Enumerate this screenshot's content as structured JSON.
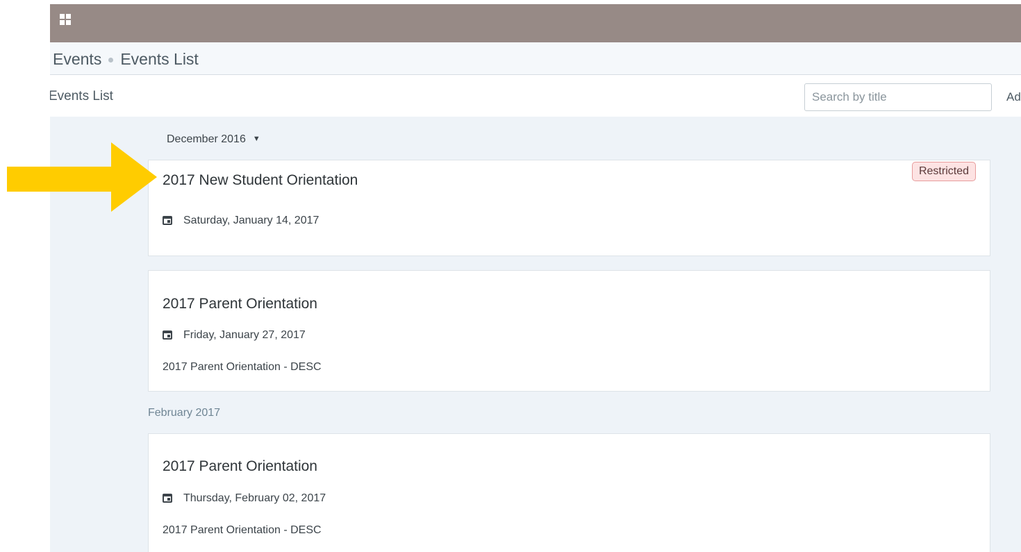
{
  "breadcrumb": {
    "root": "Events",
    "current": "Events List"
  },
  "header": {
    "title": "Events List",
    "search_placeholder": "Search by title",
    "add_label": "Ad"
  },
  "month_filter": {
    "selected": "December 2016"
  },
  "events_group_1": [
    {
      "title": "2017 New Student Orientation",
      "date": "Saturday, January 14, 2017",
      "badge": "Restricted"
    },
    {
      "title": "2017 Parent Orientation",
      "date": "Friday, January 27, 2017",
      "description": "2017 Parent Orientation - DESC"
    }
  ],
  "group_2_label": "February 2017",
  "events_group_2": [
    {
      "title": "2017 Parent Orientation",
      "date": "Thursday, February 02, 2017",
      "description": "2017 Parent Orientation - DESC"
    }
  ],
  "colors": {
    "topbar": "#978a86",
    "arrow": "#ffcc00",
    "badge_bg": "#fde3e3",
    "badge_border": "#e79c9c"
  }
}
